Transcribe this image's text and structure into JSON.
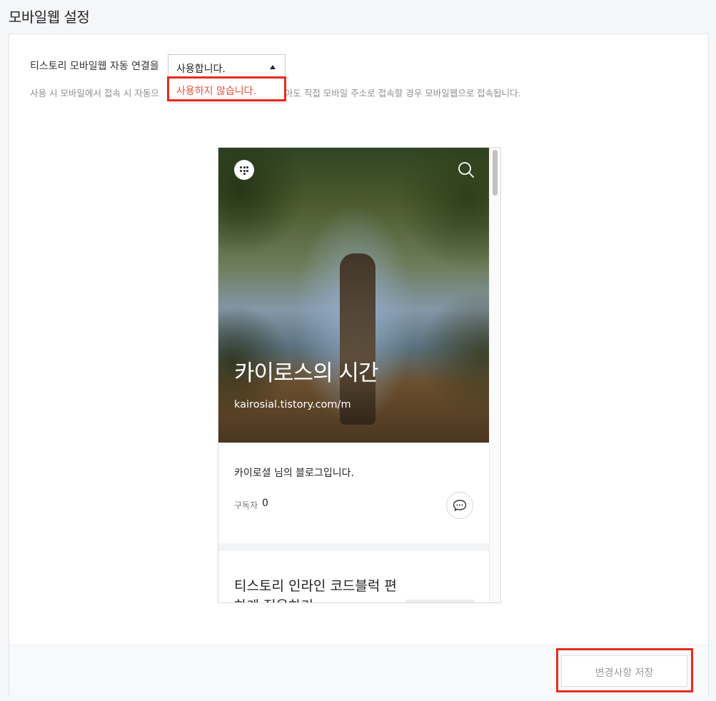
{
  "page": {
    "title": "모바일웹 설정"
  },
  "setting": {
    "label": "티스토리 모바일웹 자동 연결을",
    "select_value": "사용합니다.",
    "dropdown_option": "사용하지 않습니다.",
    "description_before": "사용 시 모바일에서 접속 시 자동으",
    "description_after": "용하지 않아도 직접 모바일 주소로 접속할 경우 모바일웹으로 접속됩니다."
  },
  "preview": {
    "blog_title": "카이로스의 시간",
    "blog_url": "kairosial.tistory.com/m",
    "blog_description": "카이로셜 님의 블로그입니다.",
    "subscribers_label": "구독자",
    "subscribers_count": "0",
    "post_title": "티스토리 인라인 코드블럭 편하게 적용하기"
  },
  "footer": {
    "save_label": "변경사항 저장"
  },
  "colors": {
    "highlight": "#e92b1e",
    "dropdown_text": "#e8503a",
    "background": "#f5f6f8"
  }
}
